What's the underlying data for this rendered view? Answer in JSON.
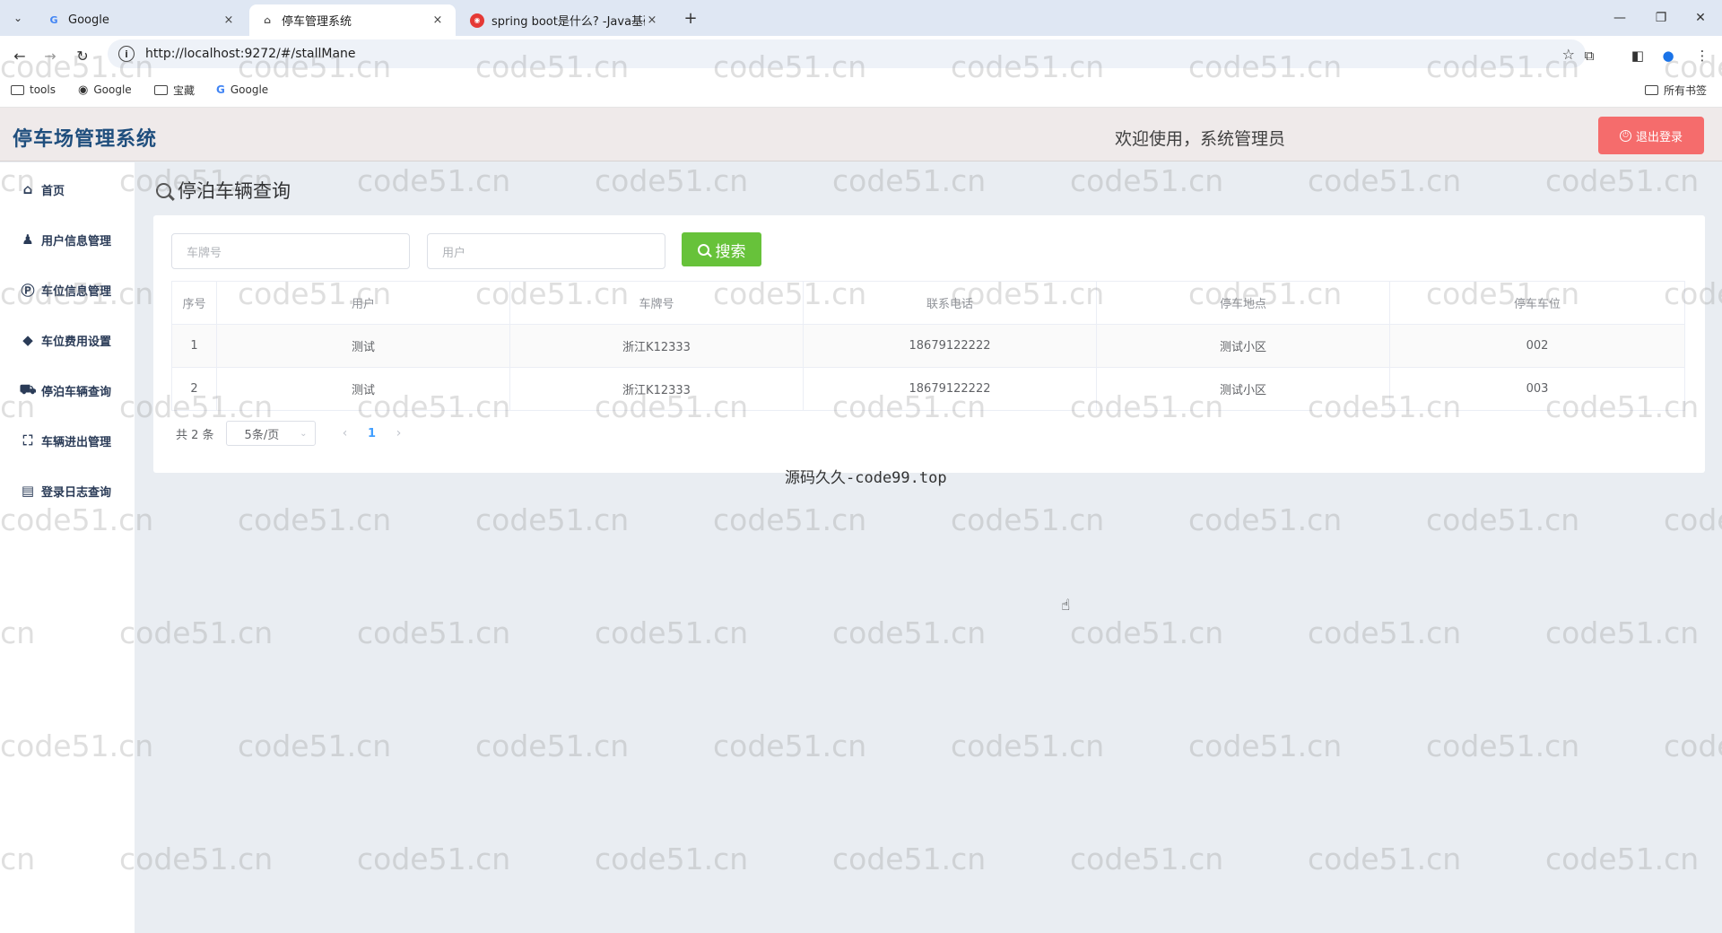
{
  "browser": {
    "tabs": [
      {
        "label": "Google",
        "close": "×"
      },
      {
        "label": "停车管理系统",
        "close": "×"
      },
      {
        "label": "spring boot是什么? -Java基础",
        "close": "×"
      }
    ],
    "new_tab": "+",
    "url": "http://localhost:9272/#/stallMane",
    "bookmarks": [
      "tools",
      "Google",
      "宝藏",
      "Google"
    ],
    "all_bookmarks": "所有书签"
  },
  "app": {
    "title": "停车场管理系统",
    "welcome": "欢迎使用，系统管理员",
    "logout": "退出登录"
  },
  "sidebar": {
    "items": [
      {
        "label": "首页",
        "icon": "home-icon"
      },
      {
        "label": "用户信息管理",
        "icon": "user-icon"
      },
      {
        "label": "车位信息管理",
        "icon": "parking-icon"
      },
      {
        "label": "车位费用设置",
        "icon": "tag-icon"
      },
      {
        "label": "停泊车辆查询",
        "icon": "car-icon"
      },
      {
        "label": "车辆进出管理",
        "icon": "scan-icon"
      },
      {
        "label": "登录日志查询",
        "icon": "log-icon"
      }
    ]
  },
  "page": {
    "title": "停泊车辆查询",
    "search": {
      "plate_placeholder": "车牌号",
      "user_placeholder": "用户",
      "button": "搜索"
    },
    "table": {
      "headers": [
        "序号",
        "用户",
        "车牌号",
        "联系电话",
        "停车地点",
        "停车车位"
      ],
      "rows": [
        [
          "1",
          "测试",
          "浙江K12333",
          "18679122222",
          "测试小区",
          "002"
        ],
        [
          "2",
          "测试",
          "浙江K12333",
          "18679122222",
          "测试小区",
          "003"
        ]
      ]
    },
    "pager": {
      "total": "共 2 条",
      "page_size": "5条/页",
      "current": "1"
    }
  },
  "footer_note": "源码久久-code99.top",
  "watermark": "code51.cn",
  "colors": {
    "title": "#1f4e7d",
    "logout": "#f56c6c",
    "search": "#67c23a",
    "page_active": "#409eff"
  }
}
